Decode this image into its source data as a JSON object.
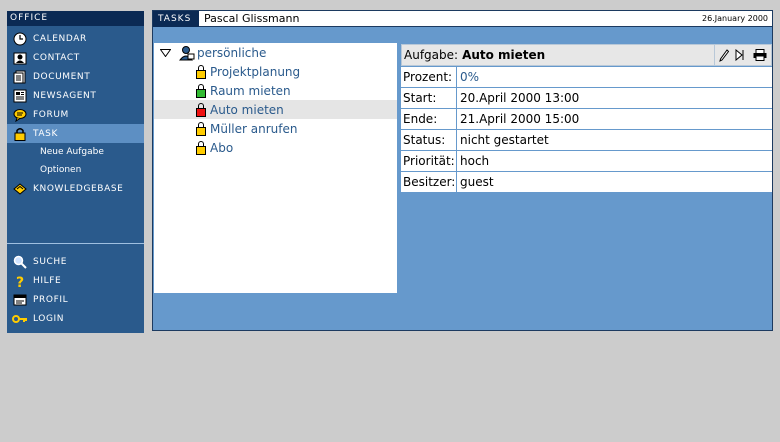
{
  "sidebar": {
    "header": "OFFICE",
    "items": [
      {
        "label": "CALENDAR",
        "icon": "clock-icon"
      },
      {
        "label": "CONTACT",
        "icon": "contact-icon"
      },
      {
        "label": "DOCUMENT",
        "icon": "document-icon"
      },
      {
        "label": "NEWSAGENT",
        "icon": "newspaper-icon"
      },
      {
        "label": "FORUM",
        "icon": "speech-bubble-icon"
      },
      {
        "label": "TASK",
        "icon": "lock-icon"
      }
    ],
    "task_sub": [
      "Neue Aufgabe",
      "Optionen"
    ],
    "knowledgebase": "KNOWLEDGEBASE",
    "bottom": [
      {
        "label": "SUCHE",
        "icon": "magnifier-icon"
      },
      {
        "label": "HILFE",
        "icon": "question-icon"
      },
      {
        "label": "PROFIL",
        "icon": "profile-icon"
      },
      {
        "label": "LOGIN",
        "icon": "key-icon"
      }
    ]
  },
  "topbar": {
    "tab": "TASKS",
    "user": "Pascal Glissmann",
    "date": "26.January 2000"
  },
  "tree": {
    "root": "persönliche",
    "items": [
      {
        "label": "Projektplanung",
        "color": "#ffcc00"
      },
      {
        "label": "Raum mieten",
        "color": "#33bb33"
      },
      {
        "label": "Auto mieten",
        "color": "#ee1111"
      },
      {
        "label": "Müller anrufen",
        "color": "#ffcc00"
      },
      {
        "label": "Abo",
        "color": "#ffcc00"
      }
    ]
  },
  "details": {
    "header_label": "Aufgabe:",
    "header_value": "Auto mieten",
    "rows": [
      {
        "key": "Prozent:",
        "value": "0%"
      },
      {
        "key": "Start:",
        "value": "20.April 2000 13:00"
      },
      {
        "key": "Ende:",
        "value": "21.April 2000 15:00"
      },
      {
        "key": "Status:",
        "value": "nicht gestartet"
      },
      {
        "key": "Priorität:",
        "value": "hoch"
      },
      {
        "key": "Besitzer:",
        "value": "guest"
      }
    ]
  },
  "colors": {
    "sidebar_bg": "#2a5a8c",
    "header_dark": "#0b2a54",
    "panel_blue": "#6699cc",
    "link_blue": "#2a5a8c"
  }
}
